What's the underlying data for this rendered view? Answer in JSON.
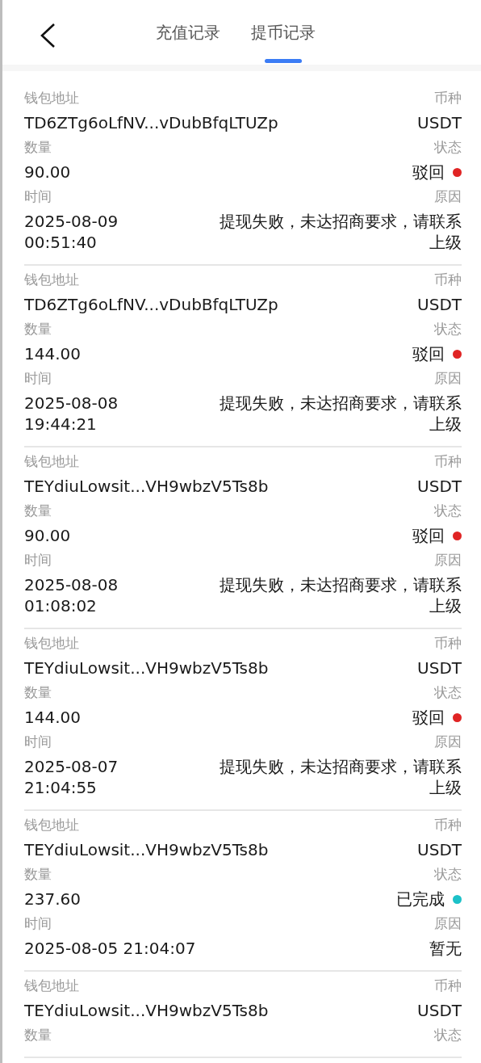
{
  "tabs": [
    {
      "label": "充值记录",
      "selected": false
    },
    {
      "label": "提币记录",
      "selected": true
    }
  ],
  "records": [
    {
      "address_label": "钱包地址",
      "address": "TD6ZTg6oLfNV...vDubBfqLTUZp",
      "currency_label": "币种",
      "currency": "USDT",
      "amount_label": "数量",
      "amount": "90.00",
      "status_label": "状态",
      "status": "驳回",
      "color": "#e02424",
      "time_label": "时间",
      "time": "2025-08-09 00:51:40",
      "reason_label": "原因",
      "reason": "提现失败，未达招商要求，请联系上级"
    },
    {
      "address_label": "钱包地址",
      "address": "TD6ZTg6oLfNV...vDubBfqLTUZp",
      "currency_label": "币种",
      "currency": "USDT",
      "amount_label": "数量",
      "amount": "144.00",
      "status_label": "状态",
      "status": "驳回",
      "color": "#e02424",
      "time_label": "时间",
      "time": "2025-08-08 19:44:21",
      "reason_label": "原因",
      "reason": "提现失败，未达招商要求，请联系上级"
    },
    {
      "address_label": "钱包地址",
      "address": "TEYdiuLowsit...VH9wbzV5Ts8b",
      "currency_label": "币种",
      "currency": "USDT",
      "amount_label": "数量",
      "amount": "90.00",
      "status_label": "状态",
      "status": "驳回",
      "color": "#e02424",
      "time_label": "时间",
      "time": "2025-08-08 01:08:02",
      "reason_label": "原因",
      "reason": "提现失败，未达招商要求，请联系上级"
    },
    {
      "address_label": "钱包地址",
      "address": "TEYdiuLowsit...VH9wbzV5Ts8b",
      "currency_label": "币种",
      "currency": "USDT",
      "amount_label": "数量",
      "amount": "144.00",
      "status_label": "状态",
      "status": "驳回",
      "color": "#e02424",
      "time_label": "时间",
      "time": "2025-08-07 21:04:55",
      "reason_label": "原因",
      "reason": "提现失败，未达招商要求，请联系上级"
    },
    {
      "address_label": "钱包地址",
      "address": "TEYdiuLowsit...VH9wbzV5Ts8b",
      "currency_label": "币种",
      "currency": "USDT",
      "amount_label": "数量",
      "amount": "237.60",
      "status_label": "状态",
      "status": "已完成",
      "color": "#1cc1c8",
      "time_label": "时间",
      "time": "2025-08-05 21:04:07",
      "reason_label": "原因",
      "reason": "暂无"
    },
    {
      "address_label": "钱包地址",
      "address": "TEYdiuLowsit...VH9wbzV5Ts8b",
      "currency_label": "币种",
      "currency": "USDT",
      "amount_label": "数量",
      "status_label": "状态"
    }
  ]
}
